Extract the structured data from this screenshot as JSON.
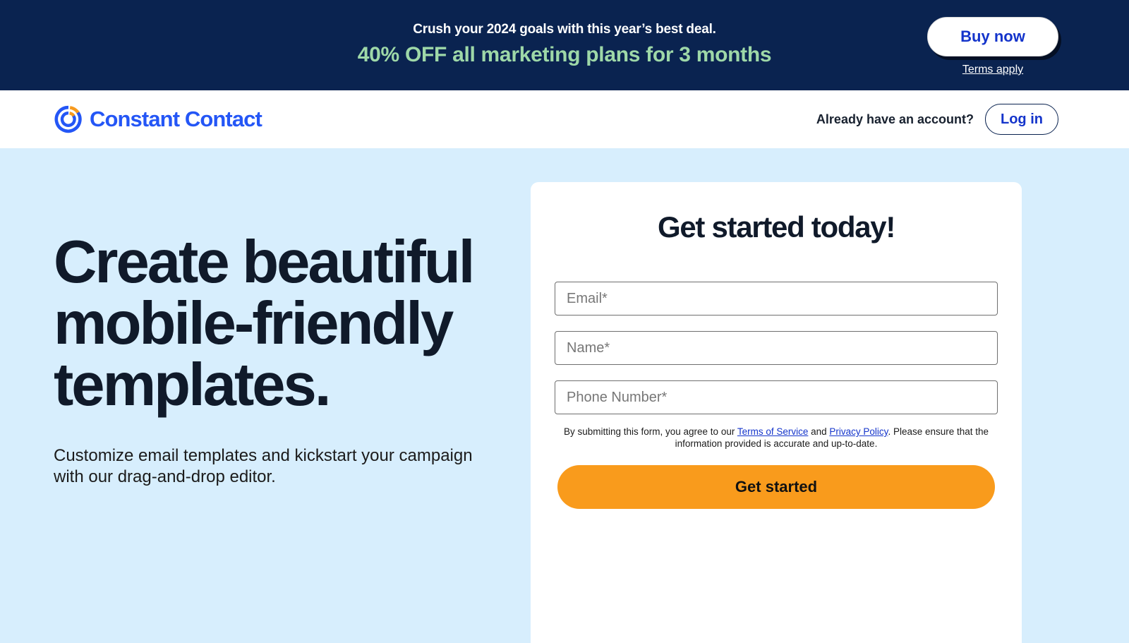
{
  "promo_banner": {
    "line1": "Crush your 2024 goals with this year’s best deal.",
    "line2": "40% OFF all marketing plans for 3 months",
    "buy_now_label": "Buy now",
    "terms_label": "Terms apply",
    "background_color": "#0a2350",
    "highlight_color": "#9ed8a8",
    "link_color": "#1434cb"
  },
  "header": {
    "brand_name": "Constant Contact",
    "brand_color": "#2456f6",
    "brand_accent_color": "#f79a1e",
    "account_question": "Already have an account?",
    "login_label": "Log in"
  },
  "hero": {
    "title": "Create beautiful mobile-friendly templates.",
    "subtitle": "Customize email templates and kickstart your campaign with our drag-and-drop editor.",
    "background_color": "#d7eefd"
  },
  "signup_form": {
    "title": "Get started today!",
    "fields": [
      {
        "name": "email",
        "placeholder": "Email*",
        "value": ""
      },
      {
        "name": "name",
        "placeholder": "Name*",
        "value": ""
      },
      {
        "name": "phone",
        "placeholder": "Phone Number*",
        "value": ""
      }
    ],
    "legal": {
      "prefix": "By submitting this form, you agree to our ",
      "terms_link": "Terms of Service",
      "middle": " and ",
      "privacy_link": "Privacy Policy",
      "suffix": ". Please ensure that the information provided is accurate and up-to-date."
    },
    "submit_label": "Get started",
    "submit_color": "#f99b1c"
  }
}
